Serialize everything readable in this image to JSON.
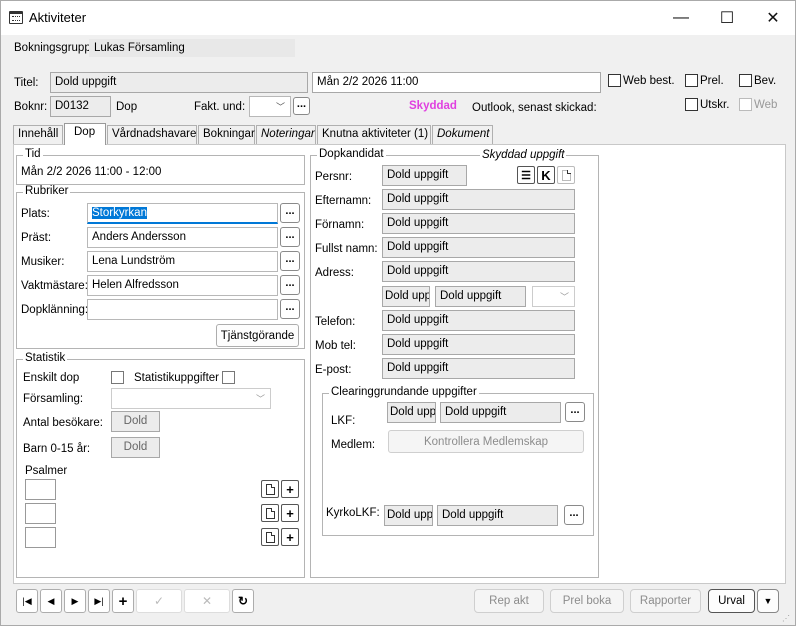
{
  "window": {
    "title": "Aktiviteter",
    "controls": {
      "minimize": "—",
      "maximize": "☐",
      "close": "✕"
    }
  },
  "header": {
    "bokningsgrupp_label": "Bokningsgrupp:",
    "bokningsgrupp_value": "Lukas Församling",
    "titel_label": "Titel:",
    "titel_value": "Dold uppgift",
    "datetime_value": "Mån 2/2 2026 11:00",
    "boknr_label": "Boknr:",
    "boknr_value": "D0132",
    "boknr_type": "Dop",
    "fakt_label": "Fakt. und:",
    "skyddad": "Skyddad",
    "outlook": "Outlook, senast skickad:",
    "web_best": "Web best.",
    "prel": "Prel.",
    "bev": "Bev.",
    "utskr": "Utskr.",
    "web": "Web"
  },
  "tabs": [
    {
      "label": "Innehåll"
    },
    {
      "label": "Dop"
    },
    {
      "label": "Vårdnadshavare"
    },
    {
      "label": "Bokningar"
    },
    {
      "label": "Noteringar"
    },
    {
      "label": "Knutna aktiviteter (1)"
    },
    {
      "label": "Dokument"
    }
  ],
  "tid": {
    "title": "Tid",
    "value": "Mån 2/2 2026 11:00 - 12:00"
  },
  "rubriker": {
    "title": "Rubriker",
    "plats_label": "Plats:",
    "plats_value": "Storkyrkan",
    "prast_label": "Präst:",
    "prast_value": "Anders Andersson",
    "musiker_label": "Musiker:",
    "musiker_value": "Lena Lundström",
    "vakt_label": "Vaktmästare:",
    "vakt_value": "Helen Alfredsson",
    "dopk_label": "Dopklänning:",
    "dopk_value": "",
    "tjanst_button": "Tjänstgörande"
  },
  "statistik": {
    "title": "Statistik",
    "enskilt": "Enskilt dop",
    "statuppg": "Statistikuppgifter",
    "forsamling": "Församling:",
    "antal": "Antal besökare:",
    "antal_value": "Dold",
    "barn": "Barn 0-15 år:",
    "barn_value": "Dold",
    "psalmer": "Psalmer"
  },
  "dopkandidat": {
    "title": "Dopkandidat",
    "skyddad_uppg": "Skyddad uppgift",
    "persnr": "Persnr:",
    "persnr_value": "Dold uppgift",
    "efternamn": "Efternamn:",
    "efternamn_value": "Dold uppgift",
    "fornamn": "Förnamn:",
    "fornamn_value": "Dold uppgift",
    "fullst": "Fullst namn:",
    "fullst_value": "Dold uppgift",
    "adress": "Adress:",
    "adress_value": "Dold uppgift",
    "postnr_value": "Dold uppgift",
    "ort_value": "Dold uppgift",
    "telefon": "Telefon:",
    "telefon_value": "Dold uppgift",
    "mobtel": "Mob tel:",
    "mobtel_value": "Dold uppgift",
    "epost": "E-post:",
    "epost_value": "Dold uppgift",
    "k_label": "K"
  },
  "clearing": {
    "title": "Clearinggrundande uppgifter",
    "lkf": "LKF:",
    "lkf_code": "Dold uppgift",
    "lkf_value": "Dold uppgift",
    "medlem": "Medlem:",
    "kontroll_button": "Kontrollera Medlemskap",
    "kyrko": "KyrkoLKF:",
    "kyrko_code": "Dold uppgift",
    "kyrko_value": "Dold uppgift"
  },
  "footer": {
    "rep_akt": "Rep akt",
    "prel_boka": "Prel boka",
    "rapporter": "Rapporter",
    "urval": "Urval"
  },
  "colors": {
    "skyddad": "#e040e0",
    "selection": "#0078d7"
  }
}
